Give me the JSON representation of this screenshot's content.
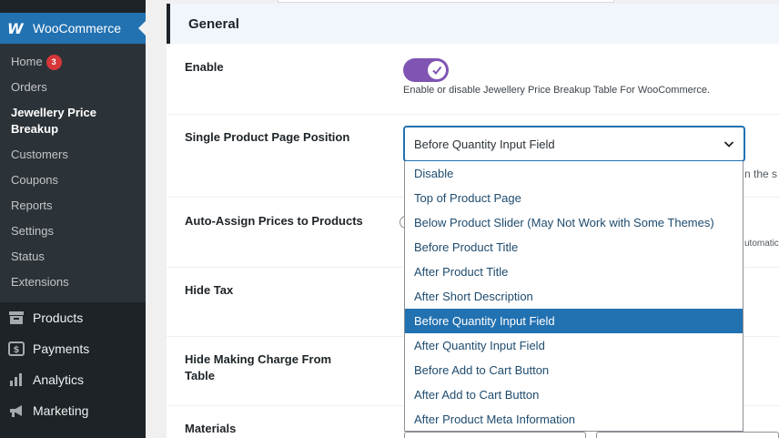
{
  "sidebar": {
    "plugin_title": "WooCommerce",
    "logo_text": "W",
    "submenu": [
      {
        "label": "Home",
        "badge": "3"
      },
      {
        "label": "Orders"
      },
      {
        "label": "Jewellery Price Breakup",
        "current": true
      },
      {
        "label": "Customers"
      },
      {
        "label": "Coupons"
      },
      {
        "label": "Reports"
      },
      {
        "label": "Settings"
      },
      {
        "label": "Status"
      },
      {
        "label": "Extensions"
      }
    ],
    "menu": [
      {
        "label": "Products",
        "icon": "archive-icon"
      },
      {
        "label": "Payments",
        "icon": "dollar-icon"
      },
      {
        "label": "Analytics",
        "icon": "bar-chart-icon"
      },
      {
        "label": "Marketing",
        "icon": "megaphone-icon"
      }
    ]
  },
  "section": {
    "title": "General"
  },
  "fields": {
    "enable": {
      "label": "Enable",
      "description": "Enable or disable Jewellery Price Breakup Table For WooCommerce.",
      "value": true
    },
    "position": {
      "label": "Single Product Page Position",
      "value": "Before Quantity Input Field",
      "partial_hint": "n the s"
    },
    "auto_assign": {
      "label": "Auto-Assign Prices to Products",
      "partial_hint": "utomatic"
    },
    "hide_tax": {
      "label": "Hide Tax"
    },
    "hide_making_charge": {
      "label": "Hide Making Charge From Table"
    },
    "materials": {
      "label": "Materials"
    }
  },
  "dropdown": {
    "options": [
      "Disable",
      "Top of Product Page",
      "Below Product Slider (May Not Work with Some Themes)",
      "Before Product Title",
      "After Product Title",
      "After Short Description",
      "Before Quantity Input Field",
      "After Quantity Input Field",
      "Before Add to Cart Button",
      "After Add to Cart Button",
      "After Product Meta Information"
    ],
    "selected": "Before Quantity Input Field"
  },
  "colors": {
    "sidebar_bg": "#1d2327",
    "submenu_bg": "#2c3338",
    "accent_blue": "#2271b1",
    "toggle_purple": "#7f54b3",
    "badge_red": "#d63638",
    "section_head_bg": "#f0f6fc"
  }
}
